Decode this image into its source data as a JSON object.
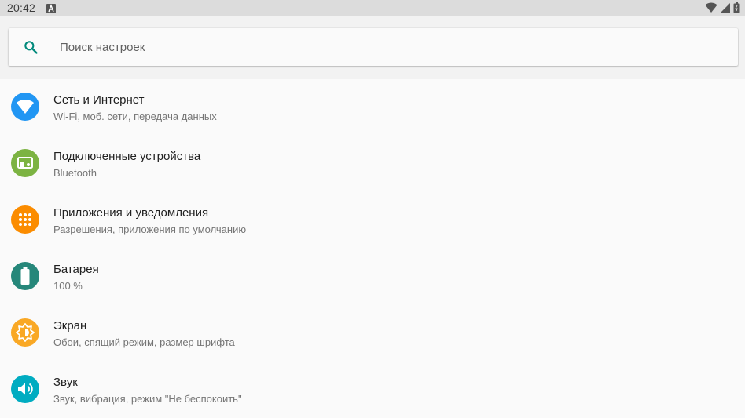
{
  "status_bar": {
    "time": "20:42",
    "icons": [
      "notification-a-icon",
      "wifi-icon",
      "signal-icon",
      "battery-icon"
    ]
  },
  "search": {
    "placeholder": "Поиск настроек"
  },
  "settings": [
    {
      "title": "Сеть и Интернет",
      "subtitle": "Wi-Fi, моб. сети, передача данных",
      "icon": "wifi-icon",
      "color": "#2196f3"
    },
    {
      "title": "Подключенные устройства",
      "subtitle": "Bluetooth",
      "icon": "devices-icon",
      "color": "#7cb342"
    },
    {
      "title": "Приложения и уведомления",
      "subtitle": "Разрешения, приложения по умолчанию",
      "icon": "apps-icon",
      "color": "#fb8c00"
    },
    {
      "title": "Батарея",
      "subtitle": "100 %",
      "icon": "battery-icon",
      "color": "#26877a"
    },
    {
      "title": "Экран",
      "subtitle": "Обои, спящий режим, размер шрифта",
      "icon": "brightness-icon",
      "color": "#f9a825"
    },
    {
      "title": "Звук",
      "subtitle": "Звук, вибрация, режим \"Не беспокоить\"",
      "icon": "volume-icon",
      "color": "#00acc1"
    }
  ]
}
